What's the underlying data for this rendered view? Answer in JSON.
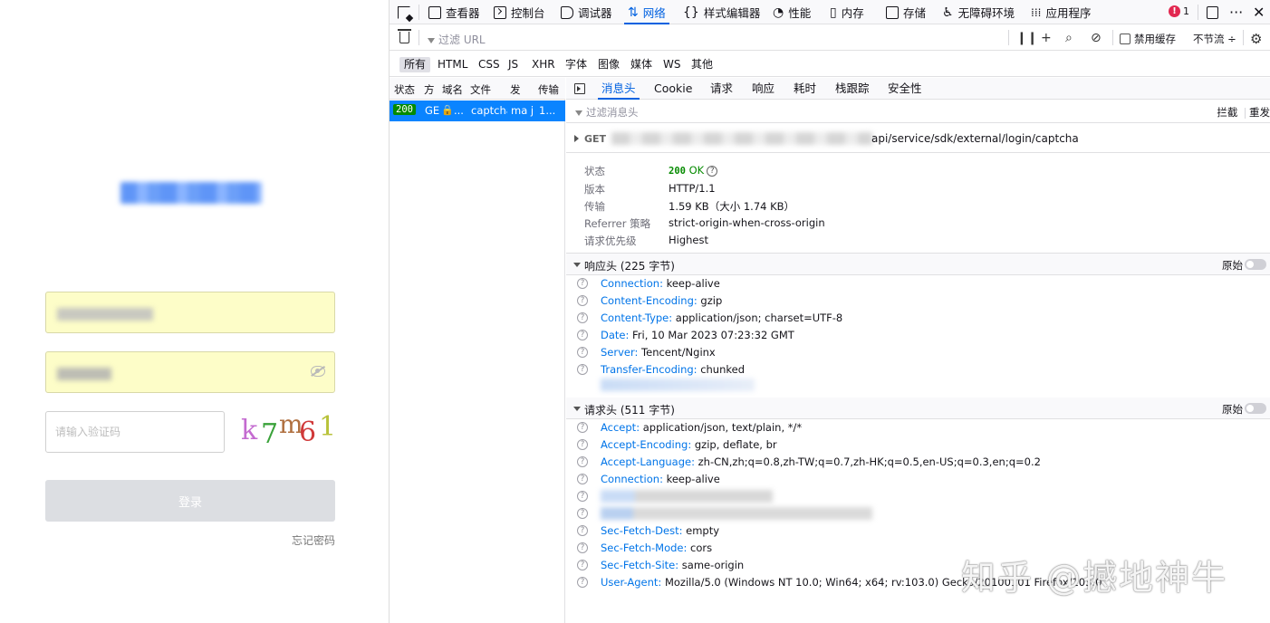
{
  "login": {
    "captcha_placeholder": "请输入验证码",
    "captcha_chars": [
      "k",
      "7",
      "m",
      "6",
      "1"
    ],
    "login_label": "登录",
    "forgot_label": "忘记密码"
  },
  "devtools": {
    "tools": [
      {
        "label": "查看器",
        "icon": "inspector-icon"
      },
      {
        "label": "控制台",
        "icon": "console-icon"
      },
      {
        "label": "调试器",
        "icon": "debugger-icon"
      },
      {
        "label": "网络",
        "icon": "network-icon",
        "active": true
      },
      {
        "label": "样式编辑器",
        "icon": "style-editor-icon"
      },
      {
        "label": "性能",
        "icon": "performance-icon"
      },
      {
        "label": "内存",
        "icon": "memory-icon"
      },
      {
        "label": "存储",
        "icon": "storage-icon"
      },
      {
        "label": "无障碍环境",
        "icon": "accessibility-icon"
      },
      {
        "label": "应用程序",
        "icon": "application-icon"
      }
    ],
    "error_count": "1",
    "filter_url_placeholder": "过滤 URL",
    "disable_cache_label": "禁用缓存",
    "throttle_label": "不节流 ÷",
    "types": [
      "所有",
      "HTML",
      "CSS",
      "JS",
      "XHR",
      "字体",
      "图像",
      "媒体",
      "WS",
      "其他"
    ],
    "request_columns": [
      "状态",
      "方",
      "域名",
      "文件",
      "发",
      "传输"
    ],
    "request_row": {
      "status": "200",
      "method": "GE",
      "domain": "...",
      "file": "captcha",
      "initiator": "ma j",
      "transferred": "1..."
    },
    "detail_tabs": [
      "消息头",
      "Cookie",
      "请求",
      "响应",
      "耗时",
      "栈跟踪",
      "安全性"
    ],
    "header_filter_placeholder": "过滤消息头",
    "block_label": "拦截",
    "resend_label": "重发",
    "method": "GET",
    "url_path": "api/service/sdk/external/login/captcha",
    "summary": {
      "status_label": "状态",
      "status_code": "200",
      "status_text": "OK",
      "version_label": "版本",
      "version": "HTTP/1.1",
      "transfer_label": "传输",
      "transfer": "1.59 KB（大小 1.74 KB）",
      "referrer_label": "Referrer 策略",
      "referrer": "strict-origin-when-cross-origin",
      "priority_label": "请求优先级",
      "priority": "Highest"
    },
    "response_headers_title": "响应头 (225 字节)",
    "request_headers_title": "请求头 (511 字节)",
    "raw_label": "原始",
    "response_headers": [
      {
        "name": "Connection",
        "value": "keep-alive"
      },
      {
        "name": "Content-Encoding",
        "value": "gzip"
      },
      {
        "name": "Content-Type",
        "value": "application/json; charset=UTF-8"
      },
      {
        "name": "Date",
        "value": "Fri, 10 Mar 2023 07:23:32 GMT"
      },
      {
        "name": "Server",
        "value": "Tencent/Nginx"
      },
      {
        "name": "Transfer-Encoding",
        "value": "chunked"
      }
    ],
    "request_headers": [
      {
        "name": "Accept",
        "value": "application/json, text/plain, */*"
      },
      {
        "name": "Accept-Encoding",
        "value": "gzip, deflate, br"
      },
      {
        "name": "Accept-Language",
        "value": "zh-CN,zh;q=0.8,zh-TW;q=0.7,zh-HK;q=0.5,en-US;q=0.3,en;q=0.2"
      },
      {
        "name": "Connection",
        "value": "keep-alive"
      },
      {
        "name": "",
        "value": ""
      },
      {
        "name": "",
        "value": ""
      },
      {
        "name": "Sec-Fetch-Dest",
        "value": "empty"
      },
      {
        "name": "Sec-Fetch-Mode",
        "value": "cors"
      },
      {
        "name": "Sec-Fetch-Site",
        "value": "same-origin"
      },
      {
        "name": "User-Agent",
        "value": "Mozilla/5.0 (Windows NT 10.0; Win64; x64; rv:103.0) Gecko/20100101 Firefox/103.0"
      }
    ]
  },
  "watermark": "知乎 @撼地神牛"
}
